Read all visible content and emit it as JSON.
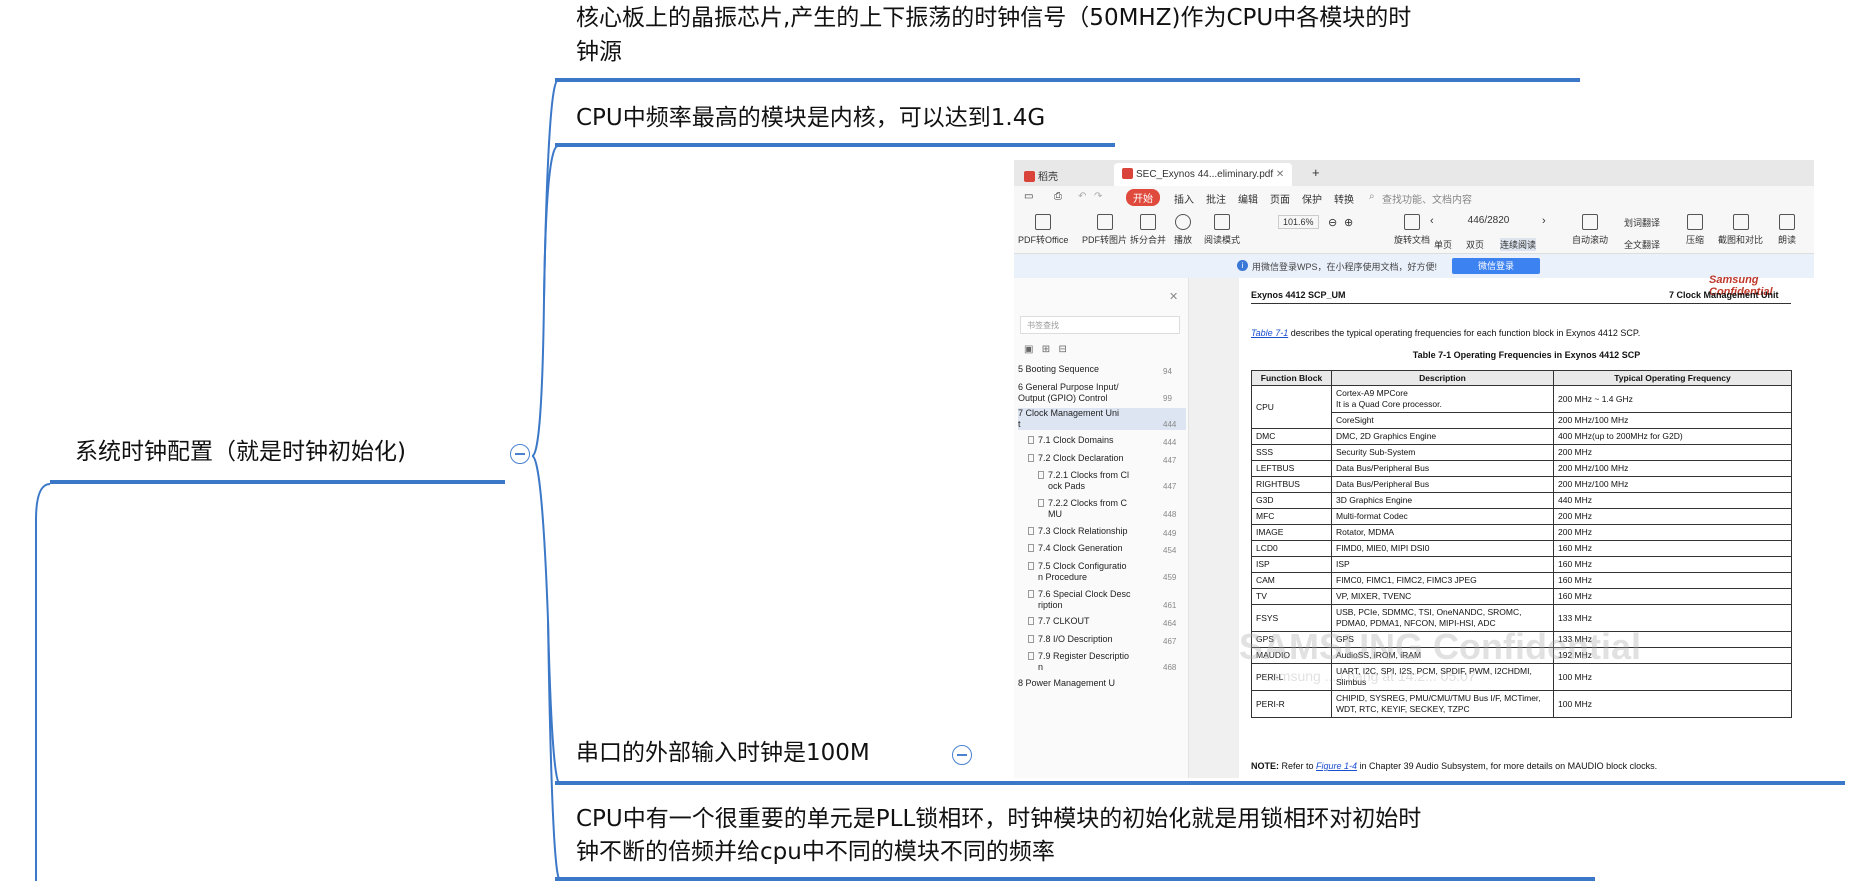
{
  "mindmap": {
    "central": "系统时钟配置（就是时钟初始化)",
    "children": [
      {
        "line1": "核心板上的晶振芯片,产生的上下振荡的时钟信号（50MHZ)作为CPU中各模块的时",
        "line2": "钟源"
      },
      {
        "line1": "CPU中频率最高的模块是内核，可以达到1.4G"
      },
      {
        "line1": "串口的外部输入时钟是100M"
      },
      {
        "line1": "CPU中有一个很重要的单元是PLL锁相环，时钟模块的初始化就是用锁相环对初始时",
        "line2": "钟不断的倍频并给cpu中不同的模块不同的频率"
      }
    ],
    "line_color": "#3c78c8"
  },
  "screenshot": {
    "tabs": [
      "稻壳",
      "SEC_Exynos 44...eliminary.pdf"
    ],
    "tab_add": "+",
    "menu": [
      "开始",
      "插入",
      "批注",
      "编辑",
      "页面",
      "保护",
      "转换"
    ],
    "search_placeholder": "查找功能、文档内容",
    "tools": [
      "PDF转Office",
      "PDF转图片",
      "拆分合并",
      "播放",
      "阅读模式",
      "旋转文档",
      "单页",
      "双页",
      "连续阅读",
      "自动滚动",
      "划词翻译",
      "全文翻译",
      "压缩",
      "截图和对比",
      "朗读"
    ],
    "zoom": "101.6%",
    "page": "446/2820",
    "banner_text": "用微信登录WPS，在小程序使用文档，好方便!",
    "banner_button": "微信登录",
    "bookmark_search": "书签查找",
    "bookmarks": [
      {
        "label": "5 Booting Sequence",
        "page": "94"
      },
      {
        "label": "6 General Purpose Input/",
        "label2": "Output (GPIO) Control",
        "page": "99"
      },
      {
        "label": "7 Clock Management Uni",
        "label2": "t",
        "page": "444"
      },
      {
        "label": "7.1 Clock Domains",
        "page": "444"
      },
      {
        "label": "7.2 Clock Declaration",
        "page": "447"
      },
      {
        "label": "7.2.1 Clocks from Cl",
        "label2": "ock Pads",
        "page": "447"
      },
      {
        "label": "7.2.2 Clocks from C",
        "label2": "MU",
        "page": "448"
      },
      {
        "label": "7.3 Clock Relationship",
        "page": "449"
      },
      {
        "label": "7.4 Clock Generation",
        "page": "454"
      },
      {
        "label": "7.5 Clock Configuratio",
        "label2": "n Procedure",
        "page": "459"
      },
      {
        "label": "7.6 Special Clock Desc",
        "label2": "ription",
        "page": "461"
      },
      {
        "label": "7.7 CLKOUT",
        "page": "464"
      },
      {
        "label": "7.8 I/O Description",
        "page": "467"
      },
      {
        "label": "7.9 Register Descriptio",
        "label2": "n",
        "page": "468"
      },
      {
        "label": "8 Power Management U",
        "page": ""
      }
    ],
    "doc": {
      "confidential": "Samsung Confidential",
      "header_left": "Exynos 4412 SCP_UM",
      "header_right": "7 Clock Management Unit",
      "intro_link": "Table 7-1",
      "intro_text": " describes the typical operating frequencies for each function block in Exynos 4412 SCP.",
      "caption": "Table 7-1     Operating Frequencies in Exynos 4412 SCP",
      "columns": [
        "Function Block",
        "Description",
        "Typical Operating Frequency"
      ],
      "rows": [
        {
          "block": "CPU",
          "desc": "Cortex-A9 MPCore",
          "desc2": "It is a Quad Core processor.",
          "freq": "200 MHz ~ 1.4 GHz"
        },
        {
          "block": "",
          "desc": "CoreSight",
          "freq": "200 MHz/100 MHz"
        },
        {
          "block": "DMC",
          "desc": "DMC, 2D Graphics Engine",
          "freq": "400 MHz(up to 200MHz for G2D)"
        },
        {
          "block": "SSS",
          "desc": "Security Sub-System",
          "freq": "200 MHz"
        },
        {
          "block": "LEFTBUS",
          "desc": "Data Bus/Peripheral Bus",
          "freq": "200 MHz/100 MHz"
        },
        {
          "block": "RIGHTBUS",
          "desc": "Data Bus/Peripheral Bus",
          "freq": "200 MHz/100 MHz"
        },
        {
          "block": "G3D",
          "desc": "3D Graphics Engine",
          "freq": "440 MHz"
        },
        {
          "block": "MFC",
          "desc": "Multi-format Codec",
          "freq": "200 MHz"
        },
        {
          "block": "IMAGE",
          "desc": "Rotator, MDMA",
          "freq": "200 MHz"
        },
        {
          "block": "LCD0",
          "desc": "FIMD0, MIE0, MIPI DSI0",
          "freq": "160 MHz"
        },
        {
          "block": "ISP",
          "desc": "ISP",
          "freq": "160 MHz"
        },
        {
          "block": "CAM",
          "desc": "FIMC0, FIMC1, FIMC2, FIMC3 JPEG",
          "freq": "160 MHz"
        },
        {
          "block": "TV",
          "desc": "VP, MIXER, TVENC",
          "freq": "160 MHz"
        },
        {
          "block": "FSYS",
          "desc": "USB, PCIe, SDMMC, TSI, OneNANDC, SROMC,",
          "desc2": "PDMA0, PDMA1, NFCON, MIPI-HSI, ADC",
          "freq": "133 MHz"
        },
        {
          "block": "GPS",
          "desc": "GPS",
          "freq": "133 MHz"
        },
        {
          "block": "MAUDIO",
          "desc": "AudioSS, iROM, iRAM",
          "freq": "192 MHz"
        },
        {
          "block": "PERI-L",
          "desc": "UART, I2C, SPI, I2S, PCM, SPDIF, PWM, I2CHDMI,",
          "desc2": "Slimbus",
          "freq": "100 MHz"
        },
        {
          "block": "PERI-R",
          "desc": "CHIPID, SYSREG, PMU/CMU/TMU Bus I/F, MCTimer,",
          "desc2": "WDT, RTC, KEYIF, SECKEY, TZPC",
          "freq": "100 MHz"
        }
      ],
      "note_bold": "NOTE:",
      "note_pre": " Refer to ",
      "note_link": "Figure 1-4",
      "note_post": " in Chapter 39 Audio Subsystem, for more details on MAUDIO block clocks.",
      "watermark": "SAMSUNG Confidential",
      "watermark2": "samsung ... l.pang at 14:2... 05.07"
    }
  }
}
